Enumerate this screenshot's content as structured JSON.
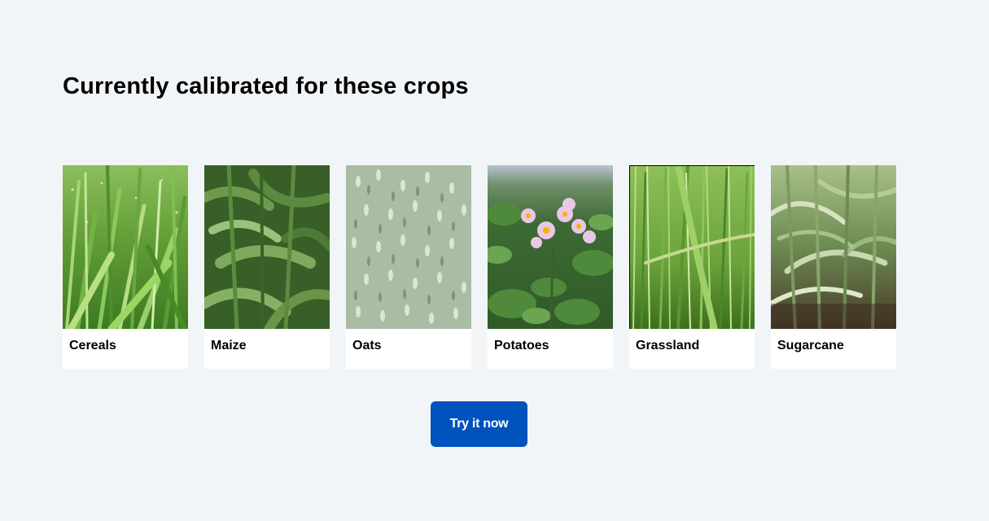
{
  "section": {
    "title": "Currently calibrated for these crops"
  },
  "crops": [
    {
      "label": "Cereals",
      "icon": "cereals-image"
    },
    {
      "label": "Maize",
      "icon": "maize-image"
    },
    {
      "label": "Oats",
      "icon": "oats-image"
    },
    {
      "label": "Potatoes",
      "icon": "potatoes-image"
    },
    {
      "label": "Grassland",
      "icon": "grassland-image"
    },
    {
      "label": "Sugarcane",
      "icon": "sugarcane-image"
    }
  ],
  "cta": {
    "label": "Try it now"
  },
  "colors": {
    "background": "#f2f5f8",
    "card": "#ffffff",
    "button": "#0052bc",
    "button_text": "#ffffff"
  }
}
